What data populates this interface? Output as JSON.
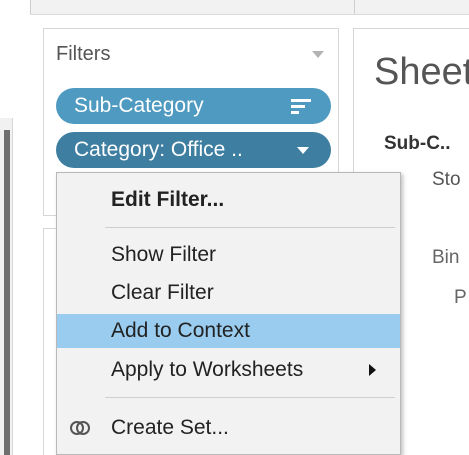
{
  "filters": {
    "title": "Filters",
    "pills": [
      {
        "label": "Sub-Category",
        "icon": "sort-icon"
      },
      {
        "label": "Category: Office ..",
        "icon": "chevron-down-icon"
      }
    ]
  },
  "sheet": {
    "title": "Sheet",
    "sub_label": "Sub-C..",
    "row1": "Sto",
    "row2": "Bin",
    "row3": "P"
  },
  "menu": {
    "items": [
      {
        "label": "Edit Filter...",
        "bold": true
      },
      {
        "label": "Show Filter"
      },
      {
        "label": "Clear Filter"
      },
      {
        "label": "Add to Context",
        "highlighted": true
      },
      {
        "label": "Apply to Worksheets",
        "submenu": true
      },
      {
        "label": "Create Set...",
        "icon": "set-icon"
      }
    ]
  },
  "colors": {
    "pill_light": "#4f9ac0",
    "pill_dark": "#3d7ea1",
    "menu_highlight": "#99ccee",
    "menu_bg": "#f2f2f2"
  }
}
